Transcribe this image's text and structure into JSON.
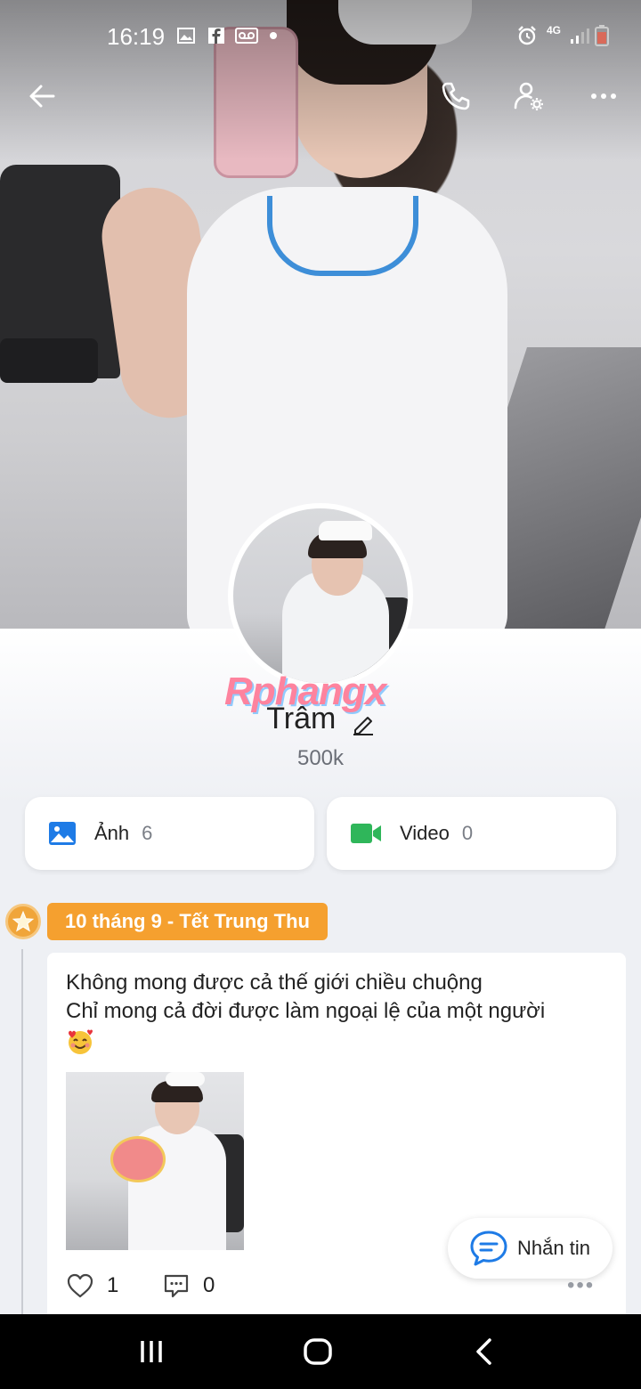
{
  "status_bar": {
    "time": "16:19",
    "network": "4G",
    "icons": [
      "gallery-icon",
      "facebook-icon",
      "voicemail-icon",
      "dot-icon",
      "alarm-icon",
      "signal-icon",
      "battery-icon"
    ]
  },
  "top_bar": {
    "icons": [
      "back-arrow-icon",
      "phone-icon",
      "user-settings-icon",
      "more-icon"
    ]
  },
  "profile": {
    "watermark": "Rphangx",
    "name": "Trâm",
    "followers": "500k"
  },
  "media": {
    "photos_label": "Ảnh",
    "photos_count": "6",
    "videos_label": "Video",
    "videos_count": "0"
  },
  "timeline": {
    "date_tag": "10 tháng 9 - Tết Trung Thu",
    "post": {
      "line1": "Không mong được cả thế giới chiều chuộng",
      "line2": "Chỉ mong cả đời được làm ngoại lệ của một người",
      "likes": "1",
      "comments": "0",
      "more": "•••"
    }
  },
  "message_button": {
    "label": "Nhắn tin"
  },
  "colors": {
    "accent_orange": "#f5a02f",
    "photo_icon_blue": "#1e7be6",
    "video_icon_green": "#2fb65a",
    "message_icon_blue": "#1e7be6"
  }
}
